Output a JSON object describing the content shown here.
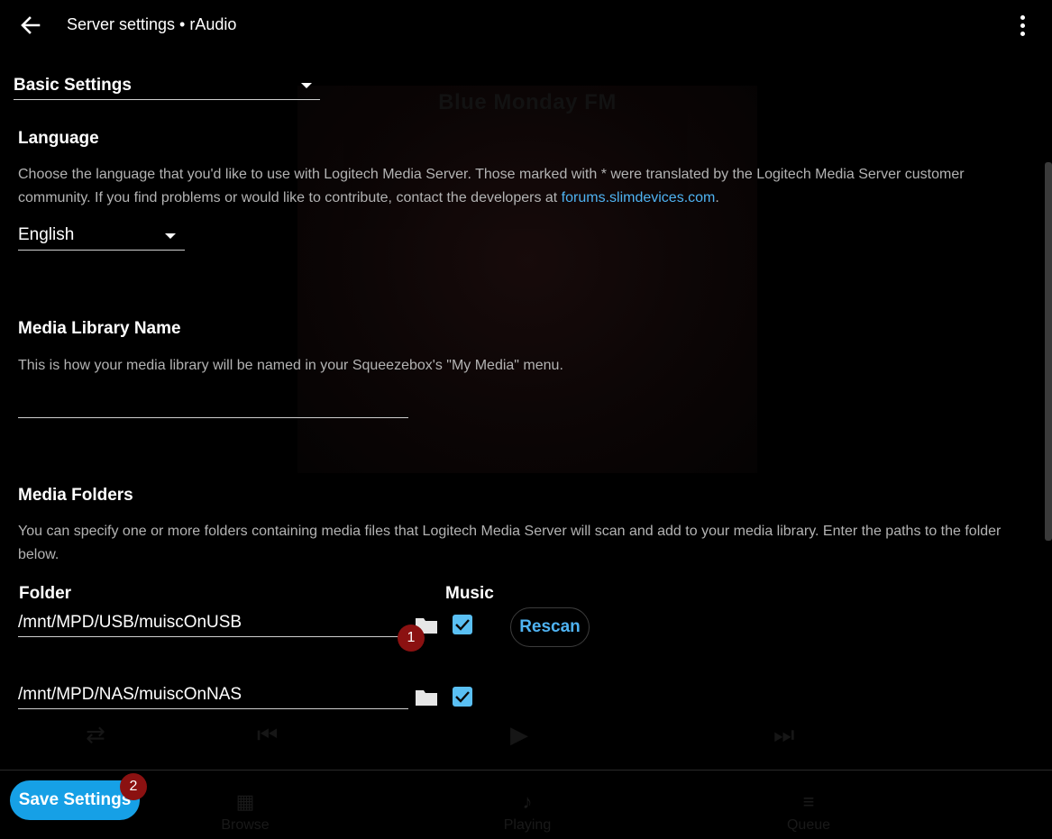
{
  "header": {
    "title": "Server settings • rAudio",
    "back_icon": "arrow-left-icon",
    "menu_icon": "more-vert-icon"
  },
  "section_select": {
    "value": "Basic Settings"
  },
  "language": {
    "title": "Language",
    "description_pre": "Choose the language that you'd like to use with Logitech Media Server. Those marked with * were translated by the Logitech Media Server customer community. If you find problems or would like to contribute, contact the developers at ",
    "link_text": "forums.slimdevices.com",
    "description_post": ".",
    "selected": "English"
  },
  "library_name": {
    "title": "Media Library Name",
    "description": "This is how your media library will be named in your Squeezebox's \"My Media\" menu.",
    "value": ""
  },
  "media_folders": {
    "title": "Media Folders",
    "description": "You can specify one or more folders containing media files that Logitech Media Server will scan and add to your media library. Enter the paths to the folder below.",
    "col_folder": "Folder",
    "col_music": "Music",
    "rows": [
      {
        "path": "/mnt/MPD/USB/muiscOnUSB",
        "music": true
      },
      {
        "path": "/mnt/MPD/NAS/muiscOnNAS",
        "music": true
      }
    ],
    "rescan_label": "Rescan"
  },
  "badges": {
    "first": "1",
    "second": "2"
  },
  "save_label": "Save Settings",
  "background": {
    "art_title": "Blue Monday FM",
    "nav": [
      "Browse",
      "Playing",
      "Queue"
    ]
  },
  "colors": {
    "accent": "#16a0e6",
    "link": "#4fb3f2",
    "checkbox": "#5ac0f4",
    "badge": "#8b1111"
  }
}
